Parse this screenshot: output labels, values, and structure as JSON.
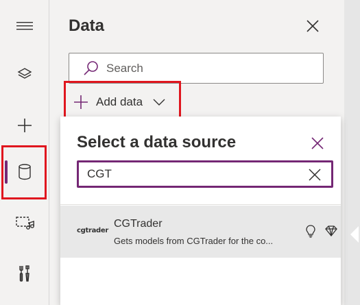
{
  "rail": {
    "items": [
      {
        "icon": "hamburger-menu-icon"
      },
      {
        "icon": "layers-icon"
      },
      {
        "icon": "plus-icon"
      },
      {
        "icon": "database-icon",
        "active": true
      },
      {
        "icon": "media-icon"
      },
      {
        "icon": "tools-icon"
      }
    ]
  },
  "panel": {
    "title": "Data",
    "search_placeholder": "Search",
    "add_data_label": "Add data"
  },
  "flyout": {
    "title": "Select a data source",
    "filter_value": "CGT",
    "results": [
      {
        "logo_text": "cgtrader",
        "name": "CGTrader",
        "description": "Gets models from CGTrader for the co..."
      }
    ]
  },
  "colors": {
    "accent": "#742774",
    "highlight": "#e0161e",
    "panel_bg": "#f3f2f1",
    "row_bg": "#e8e8e8"
  }
}
